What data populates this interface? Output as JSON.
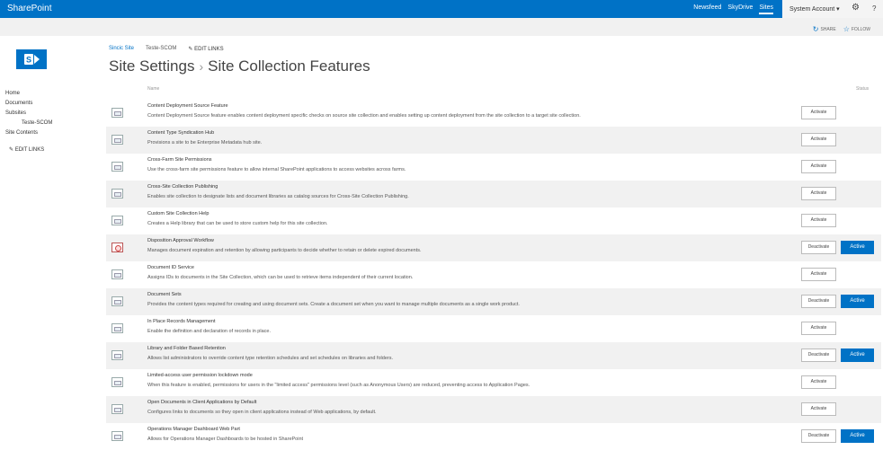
{
  "suite_bar": {
    "brand": "SharePoint",
    "links": [
      "Newsfeed",
      "SkyDrive",
      "Sites"
    ],
    "selected_link": "Sites",
    "account": "System Account",
    "account_caret": "▾",
    "gear_icon": "gear-icon",
    "help_icon": "help-icon"
  },
  "ribbon": {
    "share": "SHARE",
    "follow": "FOLLOW"
  },
  "breadcrumb": {
    "site": "Sincic Site",
    "subsite": "Teste-SCOM",
    "edit_links": "EDIT LINKS"
  },
  "title": {
    "section": "Site Settings",
    "separator": "›",
    "page": "Site Collection Features"
  },
  "left_nav": {
    "items": [
      "Home",
      "Documents",
      "Subsites"
    ],
    "sub_item": "Teste-SCOM",
    "site_contents": "Site Contents",
    "edit_links": "EDIT LINKS"
  },
  "table": {
    "col_name": "Name",
    "col_status": "Status",
    "features": [
      {
        "name": "Content Deployment Source Feature",
        "description": "Content Deployment Source feature enables content deployment specific checks on source site collection and enables setting up content deployment from the site collection to a target site collection.",
        "button": "Activate",
        "status": ""
      },
      {
        "name": "Content Type Syndication Hub",
        "description": "Provisions a site to be Enterprise Metadata hub site.",
        "button": "Activate",
        "status": ""
      },
      {
        "name": "Cross-Farm Site Permissions",
        "description": "Use the cross-farm site permissions feature to allow internal SharePoint applications to access websites across farms.",
        "button": "Activate",
        "status": ""
      },
      {
        "name": "Cross-Site Collection Publishing",
        "description": "Enables site collection to designate lists and document libraries as catalog sources for Cross-Site Collection Publishing.",
        "button": "Activate",
        "status": ""
      },
      {
        "name": "Custom Site Collection Help",
        "description": "Creates a Help library that can be used to store custom help for this site collection.",
        "button": "Activate",
        "status": ""
      },
      {
        "name": "Disposition Approval Workflow",
        "description": "Manages document expiration and retention by allowing participants to decide whether to retain or delete expired documents.",
        "button": "Deactivate",
        "status": "Active",
        "icon": "special"
      },
      {
        "name": "Document ID Service",
        "description": "Assigns IDs to documents in the Site Collection, which can be used to retrieve items independent of their current location.",
        "button": "Activate",
        "status": ""
      },
      {
        "name": "Document Sets",
        "description": "Provides the content types required for creating and using document sets. Create a document set when you want to manage multiple documents as a single work product.",
        "button": "Deactivate",
        "status": "Active"
      },
      {
        "name": "In Place Records Management",
        "description": "Enable the definition and declaration of records in place.",
        "button": "Activate",
        "status": ""
      },
      {
        "name": "Library and Folder Based Retention",
        "description": "Allows list administrators to override content type retention schedules and set schedules on libraries and folders.",
        "button": "Deactivate",
        "status": "Active"
      },
      {
        "name": "Limited-access user permission lockdown mode",
        "description": "When this feature is enabled, permissions for users in the \"limited access\" permissions level (such as Anonymous Users) are reduced, preventing access to Application Pages.",
        "button": "Activate",
        "status": ""
      },
      {
        "name": "Open Documents in Client Applications by Default",
        "description": "Configures links to documents so they open in client applications instead of Web applications, by default.",
        "button": "Activate",
        "status": ""
      },
      {
        "name": "Operations Manager Dashboard Web Part",
        "description": "Allows for Operations Manager Dashboards to be hosted in SharePoint",
        "button": "Deactivate",
        "status": "Active"
      }
    ]
  },
  "colors": {
    "accent": "#0072c6",
    "alt_row": "#f1f1f1"
  }
}
